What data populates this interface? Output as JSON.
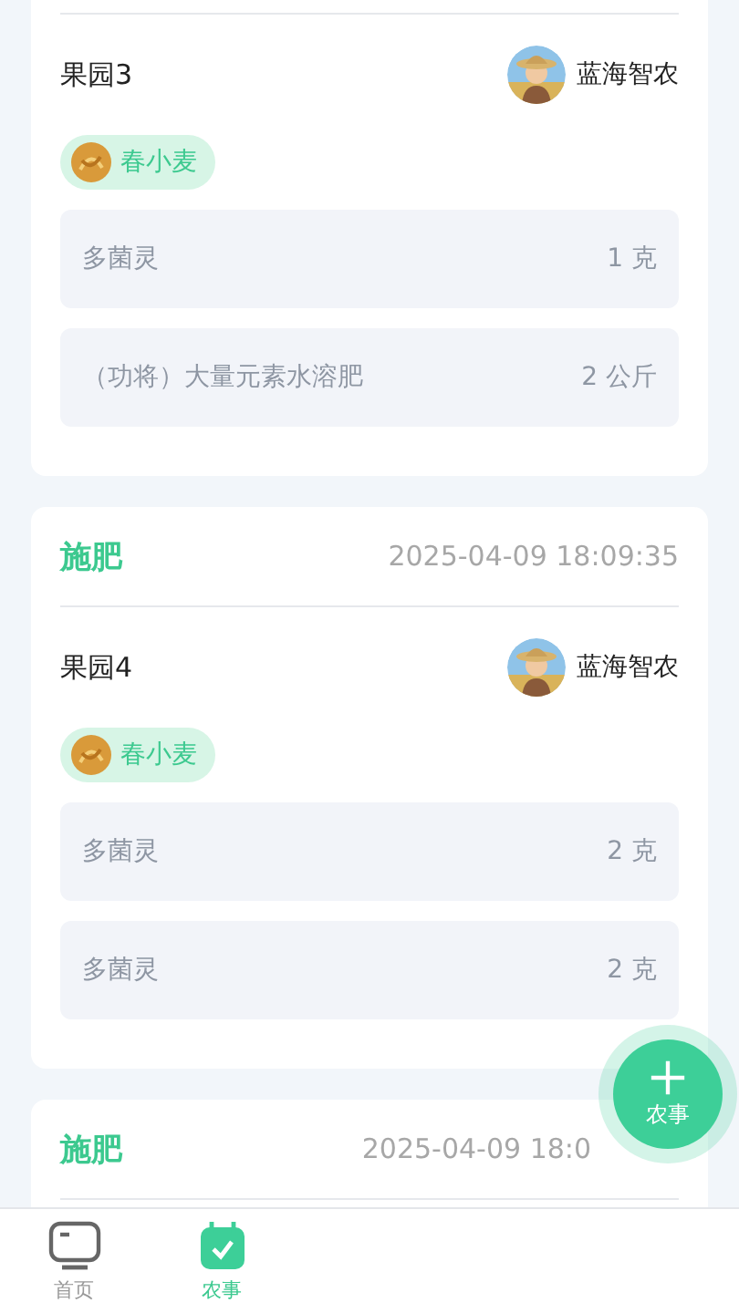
{
  "records": [
    {
      "plot": "果园3",
      "user": "蓝海智农",
      "crop": "春小麦",
      "items": [
        {
          "name": "多菌灵",
          "amount": "1 克"
        },
        {
          "name": "（功将）大量元素水溶肥",
          "amount": "2 公斤"
        }
      ]
    },
    {
      "type": "施肥",
      "time": "2025-04-09 18:09:35",
      "plot": "果园4",
      "user": "蓝海智农",
      "crop": "春小麦",
      "items": [
        {
          "name": "多菌灵",
          "amount": "2 克"
        },
        {
          "name": "多菌灵",
          "amount": "2 克"
        }
      ]
    },
    {
      "type": "施肥",
      "time": "2025-04-09 18:0"
    }
  ],
  "fab": {
    "label": "农事"
  },
  "tabs": [
    {
      "label": "首页",
      "kind": "home",
      "selected": false
    },
    {
      "label": "农事",
      "kind": "tasks",
      "selected": true
    }
  ]
}
